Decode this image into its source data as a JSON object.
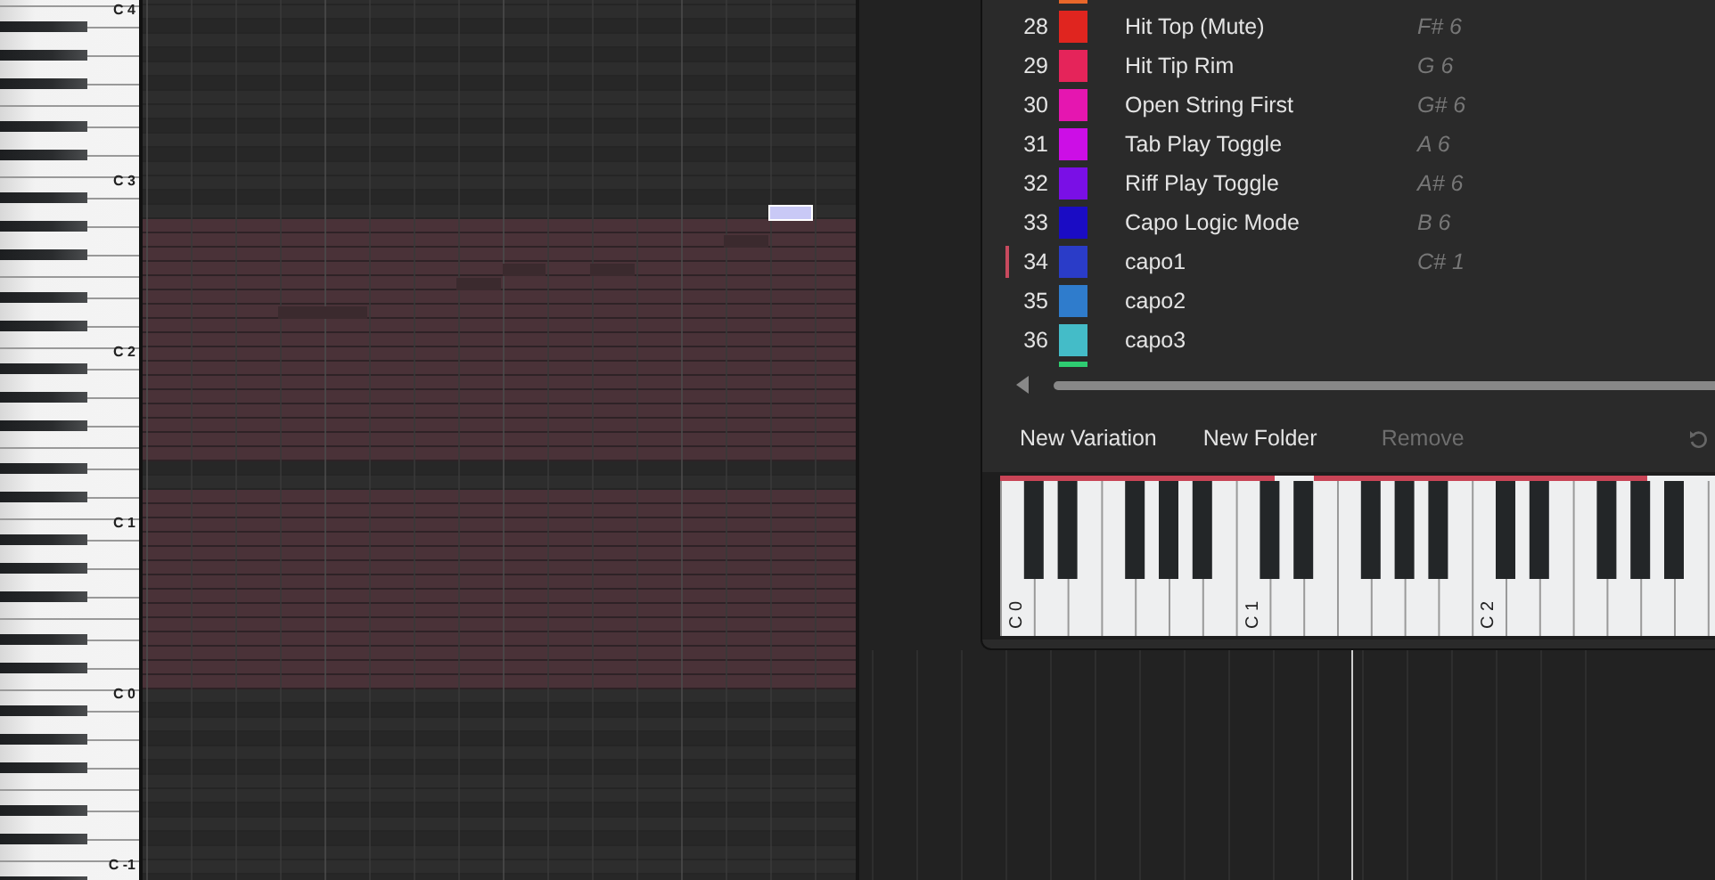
{
  "piano_roll": {
    "octave_labels": [
      "C 4",
      "C 3",
      "C 2",
      "C 1",
      "C 0",
      "C -1"
    ]
  },
  "mapping_list": {
    "rows": [
      {
        "number": "28",
        "color": "#e0251f",
        "name": "Hit Top (Mute)",
        "note": "F# 6",
        "selected": false
      },
      {
        "number": "29",
        "color": "#e5245a",
        "name": "Hit Tip Rim",
        "note": "G 6",
        "selected": false
      },
      {
        "number": "30",
        "color": "#e516b0",
        "name": "Open String First",
        "note": "G# 6",
        "selected": false
      },
      {
        "number": "31",
        "color": "#cc0ee6",
        "name": "Tab Play Toggle",
        "note": "A 6",
        "selected": false
      },
      {
        "number": "32",
        "color": "#7a0fe6",
        "name": "Riff Play Toggle",
        "note": "A# 6",
        "selected": false
      },
      {
        "number": "33",
        "color": "#1a0cc4",
        "name": "Capo Logic Mode",
        "note": "B 6",
        "selected": false
      },
      {
        "number": "34",
        "color": "#2a3cc8",
        "name": "capo1",
        "note": "C# 1",
        "selected": true
      },
      {
        "number": "35",
        "color": "#2f7ccc",
        "name": "capo2",
        "selected": false
      },
      {
        "number": "36",
        "color": "#44bcc8",
        "name": "capo3",
        "selected": false
      }
    ]
  },
  "buttons": [
    {
      "label": "New Variation",
      "disabled": false
    },
    {
      "label": "New Folder",
      "disabled": false
    },
    {
      "label": "Remove",
      "disabled": true
    }
  ],
  "keyboard": {
    "octave_labels": [
      "C 0",
      "C 1",
      "C 2"
    ]
  }
}
